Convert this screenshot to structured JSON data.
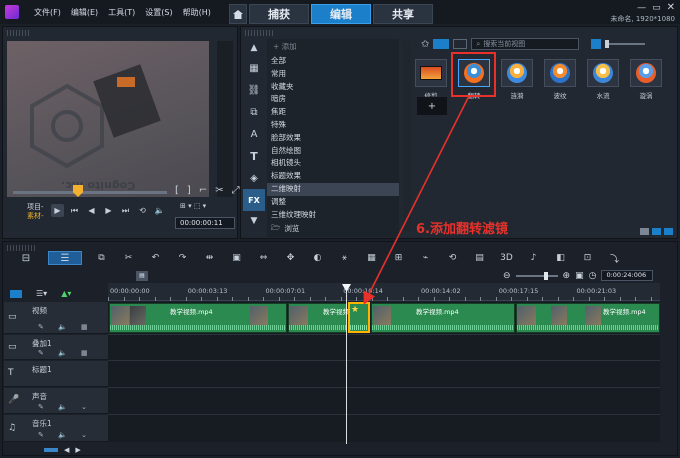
{
  "menu": [
    "文件(F)",
    "编辑(E)",
    "工具(T)",
    "设置(S)",
    "帮助(H)"
  ],
  "tabs": {
    "capture": "捕获",
    "edit": "编辑",
    "share": "共享"
  },
  "status": "未命名, 1920*1080",
  "preview": {
    "mode_project": "项目-",
    "mode_clip": "素材-",
    "watermark": "Cognito Inc.",
    "timecode": "00:00:00:11"
  },
  "library": {
    "add_label": "添加",
    "browse_label": "浏览",
    "search_placeholder": "搜索当前视图",
    "categories": [
      "全部",
      "常用",
      "收藏夹",
      "暗房",
      "焦距",
      "特殊",
      "脸部效果",
      "自然绘图",
      "相机镜头",
      "标题效果",
      "二维映射",
      "调整",
      "三维纹理映射"
    ],
    "selected_category": "二维映射",
    "effects": [
      "修剪",
      "翻转",
      "涟漪",
      "波纹",
      "水流",
      "漩涡"
    ],
    "selected_effect": "翻转"
  },
  "annotation": "6.添加翻转滤镜",
  "timeline": {
    "ruler": [
      "00:00:00:00",
      "00:00:03:13",
      "00:00:07:01",
      "00:00:10:14",
      "00:00:14:02",
      "00:00:17:15",
      "00:00:21:03"
    ],
    "total_time": "0:00:24:006",
    "tracks": [
      "视频",
      "叠加1",
      "标题1",
      "声音",
      "音乐1"
    ],
    "clip_title": "教学视频.mp4",
    "clip_title_last": "教学视频.mp4"
  },
  "colors": {
    "accent": "#1c7fc9",
    "clip": "#2b8a4f",
    "annotation": "#e8312b",
    "selection": "#ffb400"
  }
}
